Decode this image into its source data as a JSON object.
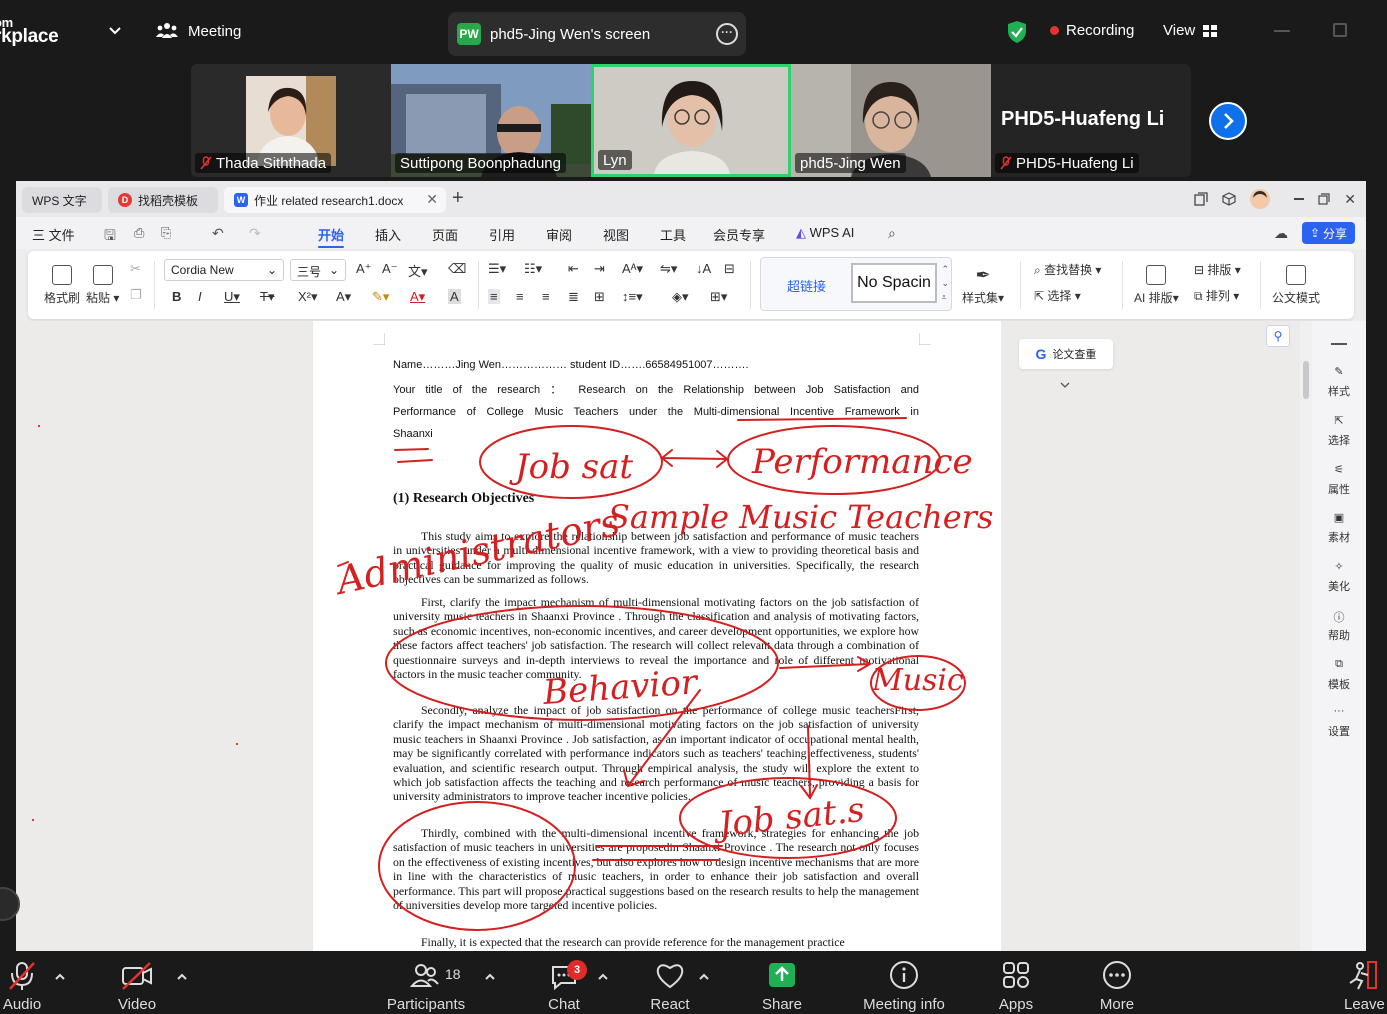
{
  "topbar": {
    "brand_line1": "om",
    "brand_line2": "rkplace",
    "meeting_label": "Meeting",
    "share_badge": "PW",
    "share_title": "phd5-Jing Wen's screen",
    "recording_label": "Recording",
    "view_label": "View",
    "colors": {
      "accent": "#0e71eb",
      "record": "#e5322d",
      "badge": "#27a94b"
    }
  },
  "participants": [
    {
      "name": "Thada Siththada",
      "muted": true
    },
    {
      "name": "Suttipong Boonphadung",
      "muted": false
    },
    {
      "name": "Lyn",
      "muted": false,
      "active_speaker": true
    },
    {
      "name": "phd5-Jing Wen",
      "muted": false
    },
    {
      "name": "PHD5-Huafeng Li",
      "muted": true,
      "avatar_text": "PHD5-Huafeng Li"
    }
  ],
  "wps": {
    "tabs": [
      {
        "label": "WPS 文字"
      },
      {
        "label": "找稻壳模板"
      },
      {
        "label": "作业 related research1.docx",
        "active": true
      }
    ],
    "menu": {
      "file": "三 文件",
      "items": [
        "开始",
        "插入",
        "页面",
        "引用",
        "审阅",
        "视图",
        "工具",
        "会员专享"
      ],
      "wps_ai": "WPS AI",
      "share": "分享"
    },
    "ribbon": {
      "format_painter": "格式刷",
      "paste": "粘贴",
      "font_name": "Cordia New",
      "font_size": "三号",
      "style_link": "超链接",
      "style_current": "No Spacin",
      "style_set": "样式集",
      "find_replace": "查找替换",
      "select": "选择",
      "ai_layout": "AI 排版",
      "layout": "排版",
      "arrange": "排列",
      "official_mode": "公文模式"
    },
    "side_button": "论文查重",
    "right_panel": [
      "样式",
      "选择",
      "属性",
      "素材",
      "美化",
      "帮助",
      "模板",
      "设置"
    ]
  },
  "document": {
    "name_line": "Name………Jing Wen……………… student ID…….66584951007……….",
    "title_line1": "Your title of the research ： Research on the Relationship between Job Satisfaction and",
    "title_line2": "Performance of College Music Teachers under the Multi-dimensional Incentive Framework in",
    "title_line3": "Shaanxi",
    "heading": "(1)  Research Objectives",
    "p1": "This study aims to explore the relationship between job satisfaction and performance of music teachers in universities under a multi-dimensional incentive framework, with a view to providing theoretical basis and practical guidance for improving the quality of music education in universities. Specifically, the research objectives can be summarized as follows.",
    "p2": "First, clarify the impact mechanism of multi-dimensional motivating factors on the job satisfaction of university music teachers in Shaanxi Province . Through the classification and analysis of motivating factors, such as economic incentives, non-economic incentives, and career development opportunities, we explore how these factors affect teachers' job satisfaction. The research will collect relevant data through a combination of questionnaire surveys and in-depth interviews to reveal the importance and role of different motivational factors in the music teacher community.",
    "p3": "Secondly, analyze the impact of job satisfaction on the performance of college music teachersFirst, clarify the impact mechanism of multi-dimensional motivating factors on the job satisfaction of university music teachers in Shaanxi Province . Job satisfaction, as an important indicator of occupational mental health, may be significantly correlated with performance indicators such as teachers' teaching effectiveness, students' evaluation, and scientific research output. Through empirical analysis, the study will explore the extent to which job satisfaction affects the teaching and research performance of music teachers, providing a basis for university administrators to improve teacher incentive policies.",
    "p4": "Thirdly, combined with the multi-dimensional incentive framework, strategies for enhancing the job satisfaction of music teachers in universities are proposedin Shaanxi Province . The research not only focuses on the effectiveness of existing incentives, but also explores how to design incentive mechanisms that are more in line with the characteristics of music teachers, in order to enhance their job satisfaction and overall performance. This part will propose practical suggestions based on the research results to help the management of universities develop more targeted incentive policies.",
    "p5": "Finally, it is expected that the research can provide reference for the management practice"
  },
  "annotations": {
    "ink_color": "#d42020",
    "labels": [
      "Job sat",
      "Performance",
      "Sample Music Teachers",
      "Administrators",
      "Behavior",
      "Music",
      "Job sat.s"
    ]
  },
  "bottombar": {
    "audio": "Audio",
    "video": "Video",
    "participants": "Participants",
    "participant_count": "18",
    "chat": "Chat",
    "chat_badge": "3",
    "react": "React",
    "share": "Share",
    "meeting_info": "Meeting info",
    "apps": "Apps",
    "more": "More",
    "leave": "Leave"
  }
}
